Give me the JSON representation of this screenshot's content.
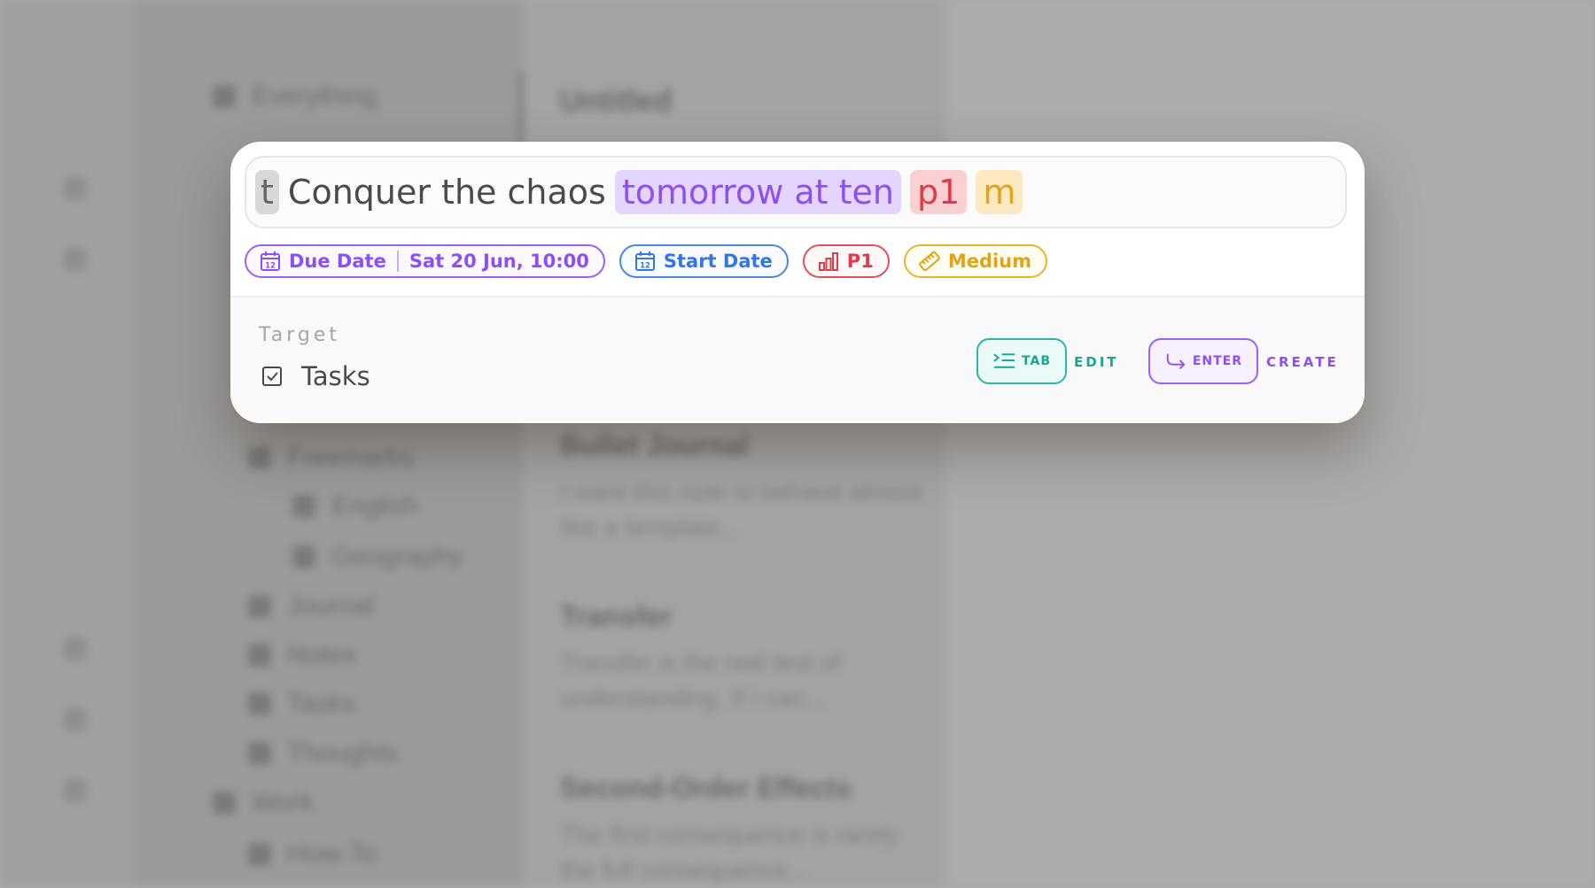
{
  "modal": {
    "input": {
      "tokens": {
        "type_prefix": "t",
        "title": "Conquer the chaos",
        "date_phrase": "tomorrow at ten",
        "priority": "p1",
        "effort": "m"
      }
    },
    "chips": {
      "due_date": {
        "label": "Due Date",
        "value": "Sat 20 Jun, 10:00",
        "icon": "calendar-icon",
        "icon_text": "12"
      },
      "start_date": {
        "label": "Start Date",
        "icon": "calendar-icon",
        "icon_text": "12"
      },
      "priority": {
        "label": "P1",
        "icon": "bar-chart-icon"
      },
      "effort": {
        "label": "Medium",
        "icon": "ruler-icon"
      }
    },
    "footer": {
      "target_label": "Target",
      "target_value": "Tasks",
      "tab_key": "TAB",
      "tab_action": "EDIT",
      "enter_key": "ENTER",
      "enter_action": "CREATE"
    }
  },
  "colors": {
    "purple": "#8e4ff2",
    "blue": "#3577e0",
    "red": "#e23a47",
    "amber": "#e2a314",
    "teal": "#19a592"
  },
  "background": {
    "sidebar_items": [
      "Everything",
      "Freemarks",
      "English",
      "Geography",
      "Journal",
      "Notes",
      "Tasks",
      "Thoughts",
      "Work",
      "How-To"
    ],
    "list_heading": "Untitled",
    "notes": [
      {
        "title": "Bullet Journal",
        "body": "I want this note to behave almost like a template..."
      },
      {
        "title": "Transfer",
        "body": "Transfer is the real test of understanding. If I can..."
      },
      {
        "title": "Second-Order Effects",
        "body": "The first consequence is rarely the full consequence..."
      }
    ]
  }
}
